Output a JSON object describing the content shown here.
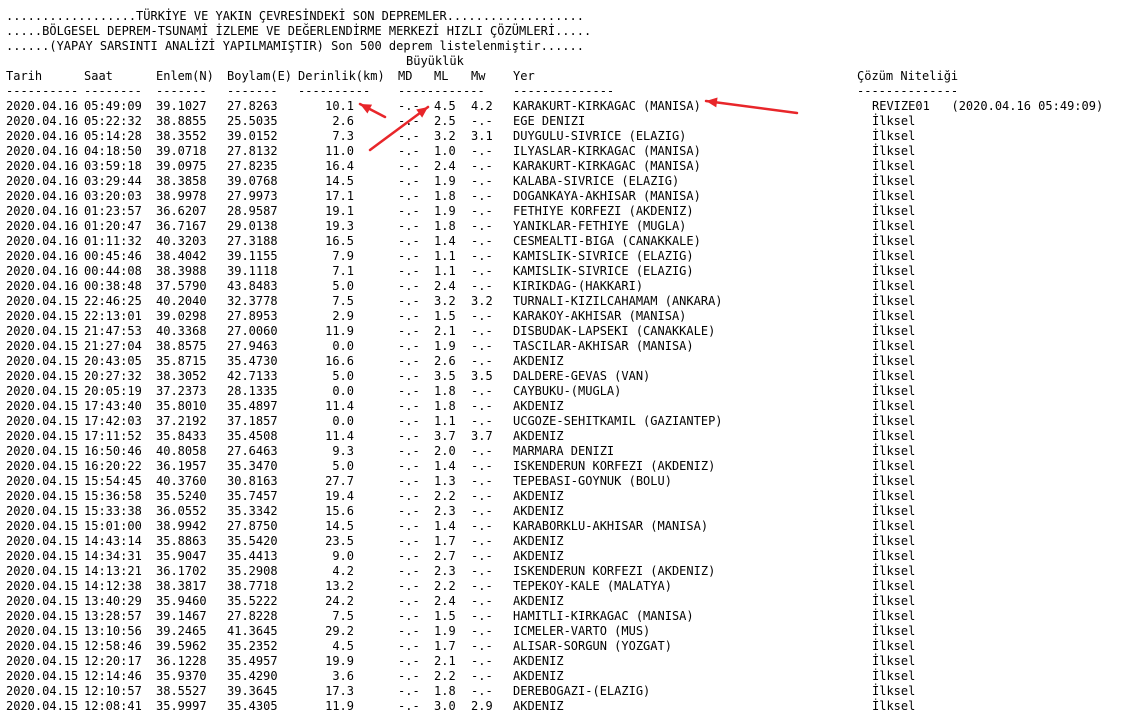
{
  "header": {
    "line1": "..................TÜRKİYE VE YAKIN ÇEVRESİNDEKİ SON DEPREMLER...................",
    "line2": ".....BÖLGESEL DEPREM-TSUNAMİ İZLEME VE DEĞERLENDİRME MERKEZİ HIZLI ÇÖZÜMLERİ.....",
    "line3": "......(YAPAY SARSINTI ANALİZİ YAPILMAMIŞTIR) Son 500 deprem listelenmiştir......"
  },
  "columns": {
    "group_magnitude": "Büyüklük",
    "date": "Tarih",
    "time": "Saat",
    "lat": "Enlem(N)",
    "lon": "Boylam(E)",
    "depth": "Derinlik(km)",
    "md": "MD",
    "ml": "ML",
    "mw": "Mw",
    "place": "Yer",
    "solution": "Çözüm Niteliği"
  },
  "separators": {
    "date": "----------",
    "time": "--------",
    "lat": "-------",
    "lon": "-------",
    "depth": "----------",
    "mag": "------------",
    "place": "--------------",
    "solution": "--------------"
  },
  "annotation_colors": {
    "arrow": "#e8262a"
  },
  "rows": [
    {
      "date": "2020.04.16",
      "time": "05:49:09",
      "lat": "39.1027",
      "lon": "27.8263",
      "depth": "10.1",
      "md": "-.-",
      "ml": "4.5",
      "mw": "4.2",
      "place": "KARAKURT-KIRKAGAC (MANISA)",
      "solution": "REVIZE01   (2020.04.16 05:49:09)"
    },
    {
      "date": "2020.04.16",
      "time": "05:22:32",
      "lat": "38.8855",
      "lon": "25.5035",
      "depth": "2.6",
      "md": "-.-",
      "ml": "2.5",
      "mw": "-.-",
      "place": "EGE DENIZI",
      "solution": "İlksel"
    },
    {
      "date": "2020.04.16",
      "time": "05:14:28",
      "lat": "38.3552",
      "lon": "39.0152",
      "depth": "7.3",
      "md": "-.-",
      "ml": "3.2",
      "mw": "3.1",
      "place": "DUYGULU-SIVRICE (ELAZIG)",
      "solution": "İlksel"
    },
    {
      "date": "2020.04.16",
      "time": "04:18:50",
      "lat": "39.0718",
      "lon": "27.8132",
      "depth": "11.0",
      "md": "-.-",
      "ml": "1.0",
      "mw": "-.-",
      "place": "ILYASLAR-KIRKAGAC (MANISA)",
      "solution": "İlksel"
    },
    {
      "date": "2020.04.16",
      "time": "03:59:18",
      "lat": "39.0975",
      "lon": "27.8235",
      "depth": "16.4",
      "md": "-.-",
      "ml": "2.4",
      "mw": "-.-",
      "place": "KARAKURT-KIRKAGAC (MANISA)",
      "solution": "İlksel"
    },
    {
      "date": "2020.04.16",
      "time": "03:29:44",
      "lat": "38.3858",
      "lon": "39.0768",
      "depth": "14.5",
      "md": "-.-",
      "ml": "1.9",
      "mw": "-.-",
      "place": "KALABA-SIVRICE (ELAZIG)",
      "solution": "İlksel"
    },
    {
      "date": "2020.04.16",
      "time": "03:20:03",
      "lat": "38.9978",
      "lon": "27.9973",
      "depth": "17.1",
      "md": "-.-",
      "ml": "1.8",
      "mw": "-.-",
      "place": "DOGANKAYA-AKHISAR (MANISA)",
      "solution": "İlksel"
    },
    {
      "date": "2020.04.16",
      "time": "01:23:57",
      "lat": "36.6207",
      "lon": "28.9587",
      "depth": "19.1",
      "md": "-.-",
      "ml": "1.9",
      "mw": "-.-",
      "place": "FETHIYE KORFEZI (AKDENIZ)",
      "solution": "İlksel"
    },
    {
      "date": "2020.04.16",
      "time": "01:20:47",
      "lat": "36.7167",
      "lon": "29.0138",
      "depth": "19.3",
      "md": "-.-",
      "ml": "1.8",
      "mw": "-.-",
      "place": "YANIKLAR-FETHIYE (MUGLA)",
      "solution": "İlksel"
    },
    {
      "date": "2020.04.16",
      "time": "01:11:32",
      "lat": "40.3203",
      "lon": "27.3188",
      "depth": "16.5",
      "md": "-.-",
      "ml": "1.4",
      "mw": "-.-",
      "place": "CESMEALTI-BIGA (CANAKKALE)",
      "solution": "İlksel"
    },
    {
      "date": "2020.04.16",
      "time": "00:45:46",
      "lat": "38.4042",
      "lon": "39.1155",
      "depth": "7.9",
      "md": "-.-",
      "ml": "1.1",
      "mw": "-.-",
      "place": "KAMISLIK-SIVRICE (ELAZIG)",
      "solution": "İlksel"
    },
    {
      "date": "2020.04.16",
      "time": "00:44:08",
      "lat": "38.3988",
      "lon": "39.1118",
      "depth": "7.1",
      "md": "-.-",
      "ml": "1.1",
      "mw": "-.-",
      "place": "KAMISLIK-SIVRICE (ELAZIG)",
      "solution": "İlksel"
    },
    {
      "date": "2020.04.16",
      "time": "00:38:48",
      "lat": "37.5790",
      "lon": "43.8483",
      "depth": "5.0",
      "md": "-.-",
      "ml": "2.4",
      "mw": "-.-",
      "place": "KIRIKDAG-(HAKKARI)",
      "solution": "İlksel"
    },
    {
      "date": "2020.04.15",
      "time": "22:46:25",
      "lat": "40.2040",
      "lon": "32.3778",
      "depth": "7.5",
      "md": "-.-",
      "ml": "3.2",
      "mw": "3.2",
      "place": "TURNALI-KIZILCAHAMAM (ANKARA)",
      "solution": "İlksel"
    },
    {
      "date": "2020.04.15",
      "time": "22:13:01",
      "lat": "39.0298",
      "lon": "27.8953",
      "depth": "2.9",
      "md": "-.-",
      "ml": "1.5",
      "mw": "-.-",
      "place": "KARAKOY-AKHISAR (MANISA)",
      "solution": "İlksel"
    },
    {
      "date": "2020.04.15",
      "time": "21:47:53",
      "lat": "40.3368",
      "lon": "27.0060",
      "depth": "11.9",
      "md": "-.-",
      "ml": "2.1",
      "mw": "-.-",
      "place": "DISBUDAK-LAPSEKI (CANAKKALE)",
      "solution": "İlksel"
    },
    {
      "date": "2020.04.15",
      "time": "21:27:04",
      "lat": "38.8575",
      "lon": "27.9463",
      "depth": "0.0",
      "md": "-.-",
      "ml": "1.9",
      "mw": "-.-",
      "place": "TASCILAR-AKHISAR (MANISA)",
      "solution": "İlksel"
    },
    {
      "date": "2020.04.15",
      "time": "20:43:05",
      "lat": "35.8715",
      "lon": "35.4730",
      "depth": "16.6",
      "md": "-.-",
      "ml": "2.6",
      "mw": "-.-",
      "place": "AKDENIZ",
      "solution": "İlksel"
    },
    {
      "date": "2020.04.15",
      "time": "20:27:32",
      "lat": "38.3052",
      "lon": "42.7133",
      "depth": "5.0",
      "md": "-.-",
      "ml": "3.5",
      "mw": "3.5",
      "place": "DALDERE-GEVAS (VAN)",
      "solution": "İlksel"
    },
    {
      "date": "2020.04.15",
      "time": "20:05:19",
      "lat": "37.2373",
      "lon": "28.1335",
      "depth": "0.0",
      "md": "-.-",
      "ml": "1.8",
      "mw": "-.-",
      "place": "CAYBUKU-(MUGLA)",
      "solution": "İlksel"
    },
    {
      "date": "2020.04.15",
      "time": "17:43:40",
      "lat": "35.8010",
      "lon": "35.4897",
      "depth": "11.4",
      "md": "-.-",
      "ml": "1.8",
      "mw": "-.-",
      "place": "AKDENIZ",
      "solution": "İlksel"
    },
    {
      "date": "2020.04.15",
      "time": "17:42:03",
      "lat": "37.2192",
      "lon": "37.1857",
      "depth": "0.0",
      "md": "-.-",
      "ml": "1.1",
      "mw": "-.-",
      "place": "UCGOZE-SEHITKAMIL (GAZIANTEP)",
      "solution": "İlksel"
    },
    {
      "date": "2020.04.15",
      "time": "17:11:52",
      "lat": "35.8433",
      "lon": "35.4508",
      "depth": "11.4",
      "md": "-.-",
      "ml": "3.7",
      "mw": "3.7",
      "place": "AKDENIZ",
      "solution": "İlksel"
    },
    {
      "date": "2020.04.15",
      "time": "16:50:46",
      "lat": "40.8058",
      "lon": "27.6463",
      "depth": "9.3",
      "md": "-.-",
      "ml": "2.0",
      "mw": "-.-",
      "place": "MARMARA DENIZI",
      "solution": "İlksel"
    },
    {
      "date": "2020.04.15",
      "time": "16:20:22",
      "lat": "36.1957",
      "lon": "35.3470",
      "depth": "5.0",
      "md": "-.-",
      "ml": "1.4",
      "mw": "-.-",
      "place": "ISKENDERUN KORFEZI (AKDENIZ)",
      "solution": "İlksel"
    },
    {
      "date": "2020.04.15",
      "time": "15:54:45",
      "lat": "40.3760",
      "lon": "30.8163",
      "depth": "27.7",
      "md": "-.-",
      "ml": "1.3",
      "mw": "-.-",
      "place": "TEPEBASI-GOYNUK (BOLU)",
      "solution": "İlksel"
    },
    {
      "date": "2020.04.15",
      "time": "15:36:58",
      "lat": "35.5240",
      "lon": "35.7457",
      "depth": "19.4",
      "md": "-.-",
      "ml": "2.2",
      "mw": "-.-",
      "place": "AKDENIZ",
      "solution": "İlksel"
    },
    {
      "date": "2020.04.15",
      "time": "15:33:38",
      "lat": "36.0552",
      "lon": "35.3342",
      "depth": "15.6",
      "md": "-.-",
      "ml": "2.3",
      "mw": "-.-",
      "place": "AKDENIZ",
      "solution": "İlksel"
    },
    {
      "date": "2020.04.15",
      "time": "15:01:00",
      "lat": "38.9942",
      "lon": "27.8750",
      "depth": "14.5",
      "md": "-.-",
      "ml": "1.4",
      "mw": "-.-",
      "place": "KARABORKLU-AKHISAR (MANISA)",
      "solution": "İlksel"
    },
    {
      "date": "2020.04.15",
      "time": "14:43:14",
      "lat": "35.8863",
      "lon": "35.5420",
      "depth": "23.5",
      "md": "-.-",
      "ml": "1.7",
      "mw": "-.-",
      "place": "AKDENIZ",
      "solution": "İlksel"
    },
    {
      "date": "2020.04.15",
      "time": "14:34:31",
      "lat": "35.9047",
      "lon": "35.4413",
      "depth": "9.0",
      "md": "-.-",
      "ml": "2.7",
      "mw": "-.-",
      "place": "AKDENIZ",
      "solution": "İlksel"
    },
    {
      "date": "2020.04.15",
      "time": "14:13:21",
      "lat": "36.1702",
      "lon": "35.2908",
      "depth": "4.2",
      "md": "-.-",
      "ml": "2.3",
      "mw": "-.-",
      "place": "ISKENDERUN KORFEZI (AKDENIZ)",
      "solution": "İlksel"
    },
    {
      "date": "2020.04.15",
      "time": "14:12:38",
      "lat": "38.3817",
      "lon": "38.7718",
      "depth": "13.2",
      "md": "-.-",
      "ml": "2.2",
      "mw": "-.-",
      "place": "TEPEKOY-KALE (MALATYA)",
      "solution": "İlksel"
    },
    {
      "date": "2020.04.15",
      "time": "13:40:29",
      "lat": "35.9460",
      "lon": "35.5222",
      "depth": "24.2",
      "md": "-.-",
      "ml": "2.4",
      "mw": "-.-",
      "place": "AKDENIZ",
      "solution": "İlksel"
    },
    {
      "date": "2020.04.15",
      "time": "13:28:57",
      "lat": "39.1467",
      "lon": "27.8228",
      "depth": "7.5",
      "md": "-.-",
      "ml": "1.5",
      "mw": "-.-",
      "place": "HAMITLI-KIRKAGAC (MANISA)",
      "solution": "İlksel"
    },
    {
      "date": "2020.04.15",
      "time": "13:10:56",
      "lat": "39.2465",
      "lon": "41.3645",
      "depth": "29.2",
      "md": "-.-",
      "ml": "1.9",
      "mw": "-.-",
      "place": "ICMELER-VARTO (MUS)",
      "solution": "İlksel"
    },
    {
      "date": "2020.04.15",
      "time": "12:58:46",
      "lat": "39.5962",
      "lon": "35.2352",
      "depth": "4.5",
      "md": "-.-",
      "ml": "1.7",
      "mw": "-.-",
      "place": "ALISAR-SORGUN (YOZGAT)",
      "solution": "İlksel"
    },
    {
      "date": "2020.04.15",
      "time": "12:20:17",
      "lat": "36.1228",
      "lon": "35.4957",
      "depth": "19.9",
      "md": "-.-",
      "ml": "2.1",
      "mw": "-.-",
      "place": "AKDENIZ",
      "solution": "İlksel"
    },
    {
      "date": "2020.04.15",
      "time": "12:14:46",
      "lat": "35.9370",
      "lon": "35.4290",
      "depth": "3.6",
      "md": "-.-",
      "ml": "2.2",
      "mw": "-.-",
      "place": "AKDENIZ",
      "solution": "İlksel"
    },
    {
      "date": "2020.04.15",
      "time": "12:10:57",
      "lat": "38.5527",
      "lon": "39.3645",
      "depth": "17.3",
      "md": "-.-",
      "ml": "1.8",
      "mw": "-.-",
      "place": "DEREBOGAZI-(ELAZIG)",
      "solution": "İlksel"
    },
    {
      "date": "2020.04.15",
      "time": "12:08:41",
      "lat": "35.9997",
      "lon": "35.4305",
      "depth": "11.9",
      "md": "-.-",
      "ml": "3.0",
      "mw": "2.9",
      "place": "AKDENIZ",
      "solution": "İlksel"
    }
  ]
}
